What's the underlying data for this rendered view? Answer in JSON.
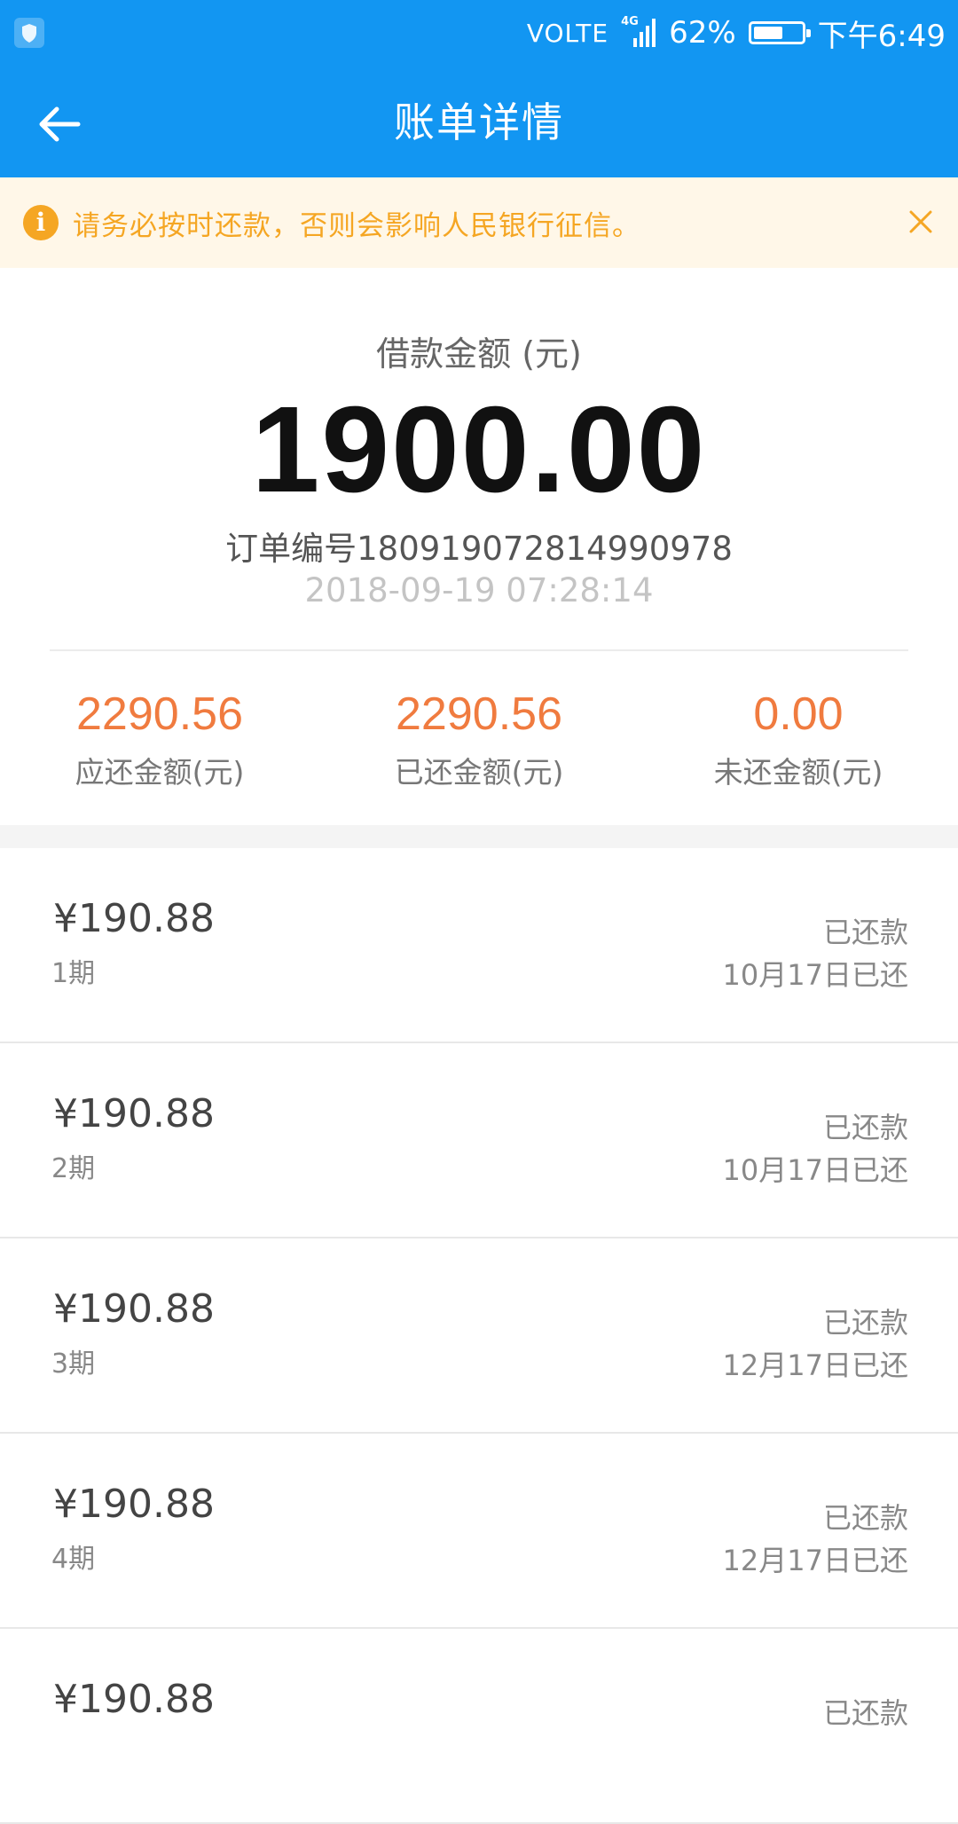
{
  "status_bar": {
    "network": "VOLTE",
    "signal_type": "4G",
    "battery": "62%",
    "battery_level": 0.62,
    "time": "下午6:49"
  },
  "nav": {
    "title": "账单详情"
  },
  "notice": {
    "text": "请务必按时还款，否则会影响人民银行征信。",
    "icon": "info-icon",
    "color": "#f5a623"
  },
  "loan": {
    "label": "借款金额 (元)",
    "amount": "1900.00",
    "order_number": "订单编号18091907281499097​8",
    "order_time": "2018-09-19 07:28:14"
  },
  "stats": [
    {
      "value": "2290.56",
      "label": "应还金额(元)"
    },
    {
      "value": "2290.56",
      "label": "已还金额(元)"
    },
    {
      "value": "0.00",
      "label": "未还金额(元)"
    }
  ],
  "installments": [
    {
      "amount": "¥190.88",
      "period": "1期",
      "status": "已还款",
      "date": "10月17日已还"
    },
    {
      "amount": "¥190.88",
      "period": "2期",
      "status": "已还款",
      "date": "10月17日已还"
    },
    {
      "amount": "¥190.88",
      "period": "3期",
      "status": "已还款",
      "date": "12月17日已还"
    },
    {
      "amount": "¥190.88",
      "period": "4期",
      "status": "已还款",
      "date": "12月17日已还"
    },
    {
      "amount": "¥190.88",
      "period": "",
      "status": "已还款",
      "date": ""
    }
  ],
  "colors": {
    "header": "#1296f2",
    "accent_orange": "#f07b3f",
    "notice_bg": "#fff7e8"
  }
}
